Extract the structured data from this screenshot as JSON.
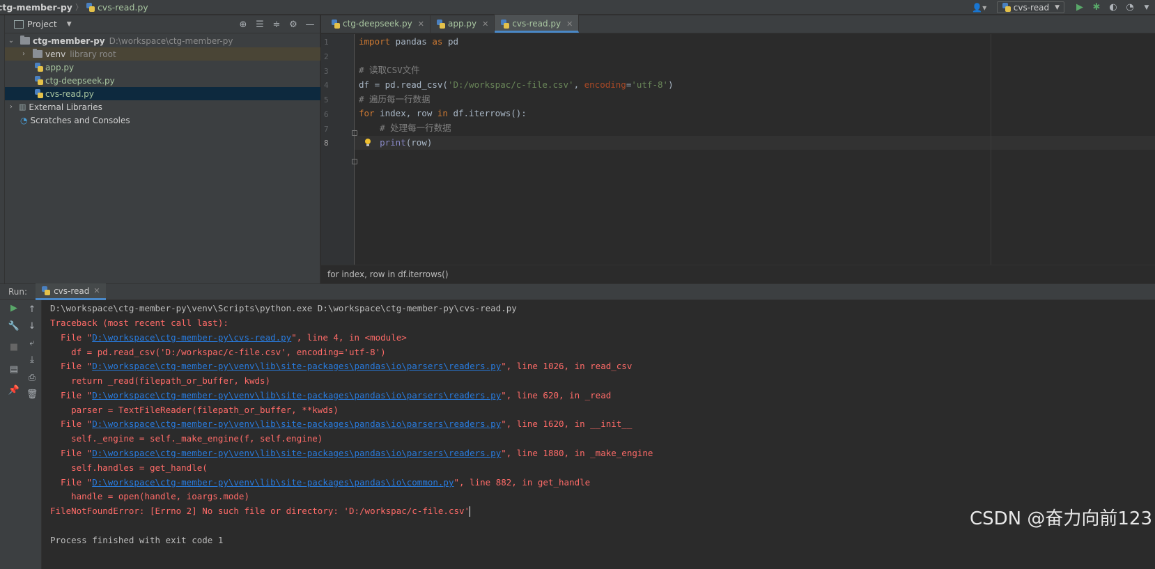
{
  "breadcrumb": {
    "project": "ctg-member-py",
    "file": "cvs-read.py"
  },
  "toolbar": {
    "run_config": "cvs-read"
  },
  "project_panel": {
    "title": "Project",
    "root": {
      "name": "ctg-member-py",
      "path": "D:\\workspace\\ctg-member-py"
    },
    "venv": {
      "name": "venv",
      "hint": "library root"
    },
    "files": [
      "app.py",
      "ctg-deepseek.py",
      "cvs-read.py"
    ],
    "external": "External Libraries",
    "scratches": "Scratches and Consoles"
  },
  "editor": {
    "tabs": [
      {
        "label": "ctg-deepseek.py",
        "active": false
      },
      {
        "label": "app.py",
        "active": false
      },
      {
        "label": "cvs-read.py",
        "active": true
      }
    ],
    "line_numbers": [
      "1",
      "2",
      "3",
      "4",
      "5",
      "6",
      "7",
      "8"
    ],
    "code": {
      "l1_kw1": "import",
      "l1_mod": " pandas ",
      "l1_kw2": "as",
      "l1_alias": " pd",
      "l3": "# 读取CSV文件",
      "l4_a": "df = pd.read_csv(",
      "l4_str": "'D:/workspac/c-file.csv'",
      "l4_b": ", ",
      "l4_param": "encoding",
      "l4_c": "=",
      "l4_str2": "'utf-8'",
      "l4_d": ")",
      "l5": "# 遍历每一行数据",
      "l6_kw1": "for",
      "l6_a": " index, row ",
      "l6_kw2": "in",
      "l6_b": " df.iterrows():",
      "l7": "    # 处理每一行数据",
      "l8_pre": "    ",
      "l8_fn": "print",
      "l8_rest": "(row)"
    },
    "breadcrumb_bar": "for index, row in df.iterrows()"
  },
  "run_panel": {
    "label": "Run:",
    "tab": "cvs-read",
    "output": [
      {
        "type": "norm",
        "text": "D:\\workspace\\ctg-member-py\\venv\\Scripts\\python.exe D:\\workspace\\ctg-member-py\\cvs-read.py"
      },
      {
        "type": "err",
        "text": "Traceback (most recent call last):"
      },
      {
        "type": "err",
        "pre": "  File \"",
        "link": "D:\\workspace\\ctg-member-py\\cvs-read.py",
        "post": "\", line 4, in <module>"
      },
      {
        "type": "err",
        "text": "    df = pd.read_csv('D:/workspac/c-file.csv', encoding='utf-8')"
      },
      {
        "type": "err",
        "pre": "  File \"",
        "link": "D:\\workspace\\ctg-member-py\\venv\\lib\\site-packages\\pandas\\io\\parsers\\readers.py",
        "post": "\", line 1026, in read_csv"
      },
      {
        "type": "err",
        "text": "    return _read(filepath_or_buffer, kwds)"
      },
      {
        "type": "err",
        "pre": "  File \"",
        "link": "D:\\workspace\\ctg-member-py\\venv\\lib\\site-packages\\pandas\\io\\parsers\\readers.py",
        "post": "\", line 620, in _read"
      },
      {
        "type": "err",
        "text": "    parser = TextFileReader(filepath_or_buffer, **kwds)"
      },
      {
        "type": "err",
        "pre": "  File \"",
        "link": "D:\\workspace\\ctg-member-py\\venv\\lib\\site-packages\\pandas\\io\\parsers\\readers.py",
        "post": "\", line 1620, in __init__"
      },
      {
        "type": "err",
        "text": "    self._engine = self._make_engine(f, self.engine)"
      },
      {
        "type": "err",
        "pre": "  File \"",
        "link": "D:\\workspace\\ctg-member-py\\venv\\lib\\site-packages\\pandas\\io\\parsers\\readers.py",
        "post": "\", line 1880, in _make_engine"
      },
      {
        "type": "err",
        "text": "    self.handles = get_handle("
      },
      {
        "type": "err",
        "pre": "  File \"",
        "link": "D:\\workspace\\ctg-member-py\\venv\\lib\\site-packages\\pandas\\io\\common.py",
        "post": "\", line 882, in get_handle"
      },
      {
        "type": "err",
        "text": "    handle = open(handle, ioargs.mode)"
      },
      {
        "type": "err",
        "text": "FileNotFoundError: [Errno 2] No such file or directory: 'D:/workspac/c-file.csv'",
        "cursor": true
      },
      {
        "type": "norm",
        "text": ""
      },
      {
        "type": "norm",
        "text": "Process finished with exit code 1"
      }
    ]
  },
  "watermark": "CSDN @奋力向前123",
  "colors": {
    "accent": "#4a88c7",
    "error": "#ff6b68",
    "link": "#287bde",
    "keyword": "#cc7832"
  },
  "icons": [
    "python-file-icon",
    "folder-icon",
    "run-icon",
    "debug-icon",
    "settings-icon",
    "lightbulb-icon"
  ]
}
